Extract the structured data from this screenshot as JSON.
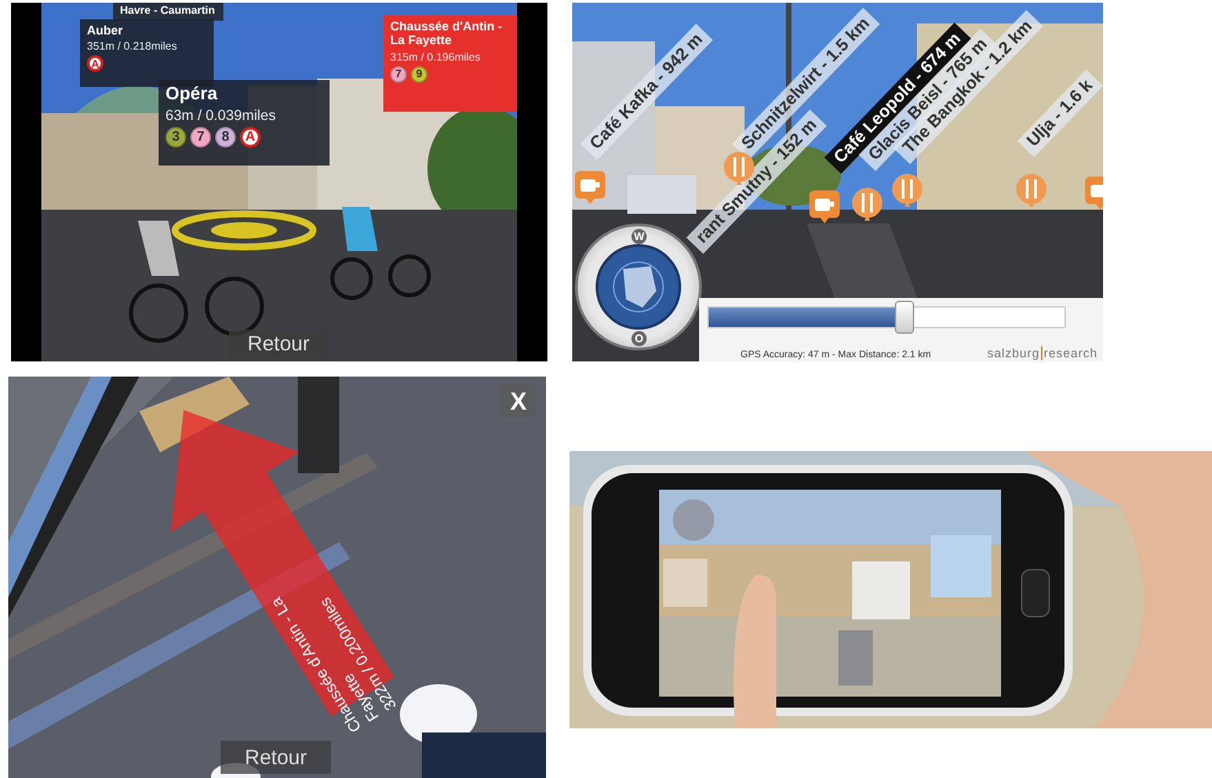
{
  "metro_view": {
    "labels": [
      {
        "kind": "back",
        "name": "Havre - Caumartin"
      },
      {
        "kind": "dark",
        "name": "Auber",
        "distance": "351m / 0.218miles",
        "lines": [
          {
            "kind": "rer",
            "code": "A",
            "color": "#ffffff"
          }
        ]
      },
      {
        "kind": "dark",
        "name": "Opéra",
        "distance": "63m / 0.039miles",
        "lines": [
          {
            "kind": "metro",
            "code": "3",
            "color": "#9aa83a"
          },
          {
            "kind": "metro",
            "code": "7",
            "color": "#f2a7c3"
          },
          {
            "kind": "metro",
            "code": "8",
            "color": "#cdb0d8"
          },
          {
            "kind": "rer",
            "code": "A",
            "color": "#ffffff"
          }
        ]
      },
      {
        "kind": "red",
        "name": "Chaussée d'Antin - La Fayette",
        "distance": "315m / 0.196miles",
        "lines": [
          {
            "kind": "metro",
            "code": "7",
            "color": "#f2a7c3"
          },
          {
            "kind": "metro",
            "code": "9",
            "color": "#c4c434"
          }
        ]
      }
    ],
    "button": "Retour"
  },
  "restaurant_view": {
    "labels": [
      {
        "text": "Café Kafka - 942 m",
        "selected": false
      },
      {
        "text": "Schnitzelwirt - 1.5 km",
        "selected": false
      },
      {
        "text": "rant Smutny - 152 m",
        "selected": false
      },
      {
        "text": "Café Leopold - 674 m",
        "selected": true
      },
      {
        "text": "Glacis Beisl - 765 m",
        "selected": false
      },
      {
        "text": "The Bangkok - 1.2 km",
        "selected": false
      },
      {
        "text": "Ulja - 1.6 k",
        "selected": false
      }
    ],
    "pins": [
      {
        "kind": "cafe"
      },
      {
        "kind": "restaurant"
      },
      {
        "kind": "cafe"
      },
      {
        "kind": "restaurant"
      },
      {
        "kind": "restaurant"
      },
      {
        "kind": "restaurant"
      },
      {
        "kind": "cafe"
      }
    ],
    "compass": [
      "W",
      "O"
    ],
    "slider": {
      "level": 0.55
    },
    "status": "GPS Accuracy: 47 m - Max Distance: 2.1 km",
    "logo": [
      "salzburg",
      "research"
    ]
  },
  "navigation_view": {
    "arrow_text": [
      "Chaussée d'Antin - La",
      "Fayette",
      "322m / 0.200miles"
    ],
    "close": "X",
    "button": "Retour"
  }
}
